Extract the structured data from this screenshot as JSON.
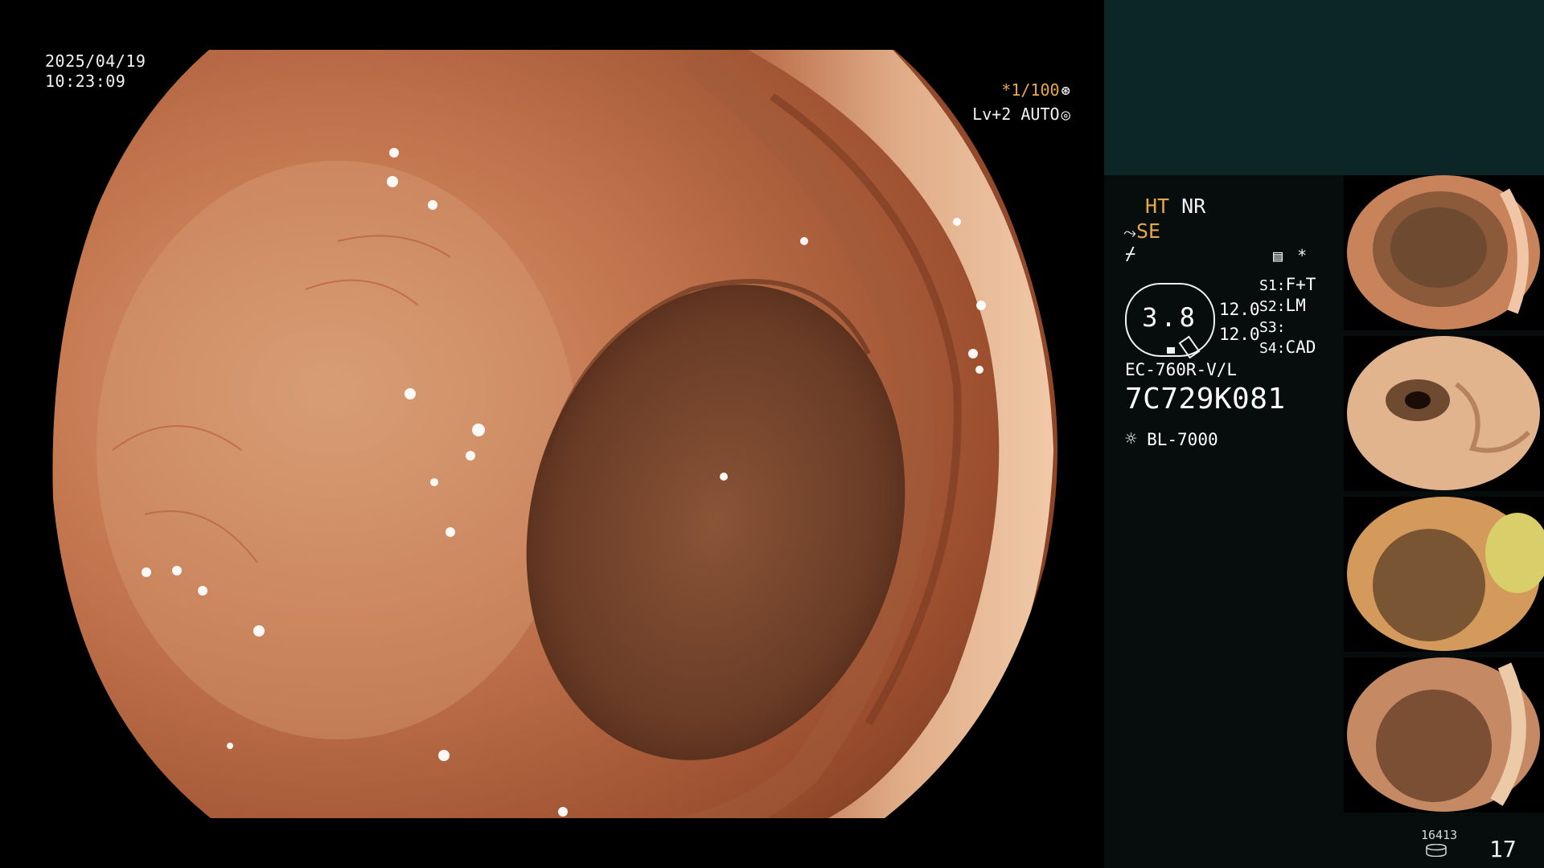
{
  "endoscope_view": {
    "date": "2025/04/19",
    "time": "10:23:09",
    "shutter": "*1/100",
    "enhance": "Lv+2",
    "iris": "AUTO",
    "iris_icon": "iris-icon",
    "shutter_icon": "shutter-icon"
  },
  "status": {
    "ht_label": "HT",
    "nr_label": "NR",
    "se_label": "SE",
    "gauge_value": "3.8",
    "param1": "12.0",
    "param2": "12.0",
    "asterisk": "*",
    "s1_label": "S1:",
    "s1_value": "F+T",
    "s2_label": "S2:",
    "s2_value": "LM",
    "s3_label": "S3:",
    "s3_value": "",
    "s4_label": "S4:",
    "s4_value": "CAD",
    "scope_model": "EC-760R-V/L",
    "scope_serial": "7C729K081",
    "light_source": "BL-7000",
    "colors": {
      "accent": "#e8a845",
      "panel_top": "#0c2627",
      "panel": "#070d0d"
    }
  },
  "storage": {
    "remaining": "16413",
    "image_count": "17"
  }
}
